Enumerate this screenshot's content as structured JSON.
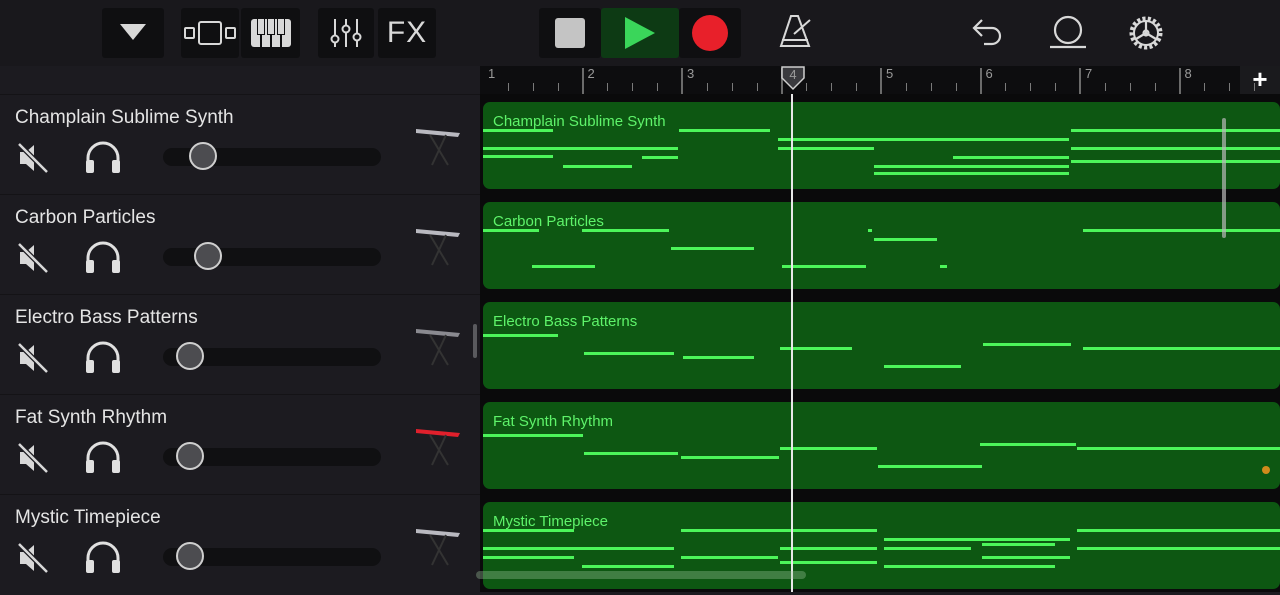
{
  "toolbar": {
    "browser_icon": "triangle-down-icon",
    "tracks_view_icon": "tracks-view-icon",
    "keyboard_icon": "piano-keys-icon",
    "mixer_icon": "mixer-sliders-icon",
    "fx_label": "FX",
    "stop_icon": "stop-icon",
    "play_icon": "play-icon",
    "record_icon": "record-icon",
    "metronome_icon": "metronome-icon",
    "undo_icon": "undo-icon",
    "loop_icon": "loop-browser-icon",
    "settings_icon": "gear-icon",
    "colors": {
      "play": "#3ad65a",
      "record": "#e8202a",
      "note": "#4cf55a",
      "region": "#0d5712"
    }
  },
  "ruler": {
    "bars": [
      "1",
      "2",
      "3",
      "4",
      "5",
      "6",
      "7",
      "8"
    ],
    "playhead_bar": "4",
    "add_label": "+"
  },
  "tracks": [
    {
      "name": "Champlain Sublime Synth",
      "volume": 0.12,
      "instrument": "synth-keyboard-icon",
      "notes": [
        [
          0,
          0.088,
          35
        ],
        [
          0,
          0.245,
          53
        ],
        [
          0,
          0.088,
          61
        ],
        [
          0.1,
          0.187,
          71
        ],
        [
          0.246,
          0.36,
          35
        ],
        [
          0.2,
          0.245,
          62
        ],
        [
          0.37,
          0.49,
          44
        ],
        [
          0.37,
          0.49,
          53
        ],
        [
          0.49,
          0.735,
          44
        ],
        [
          0.49,
          0.735,
          71
        ],
        [
          0.49,
          0.735,
          78
        ],
        [
          0.59,
          0.735,
          62
        ],
        [
          0.738,
          1,
          35
        ],
        [
          0.738,
          1,
          53
        ],
        [
          0.738,
          1,
          66
        ]
      ]
    },
    {
      "name": "Carbon Particles",
      "volume": 0.14,
      "instrument": "synth-keyboard-icon",
      "notes": [
        [
          0,
          0.07,
          35
        ],
        [
          0.124,
          0.233,
          35
        ],
        [
          0.062,
          0.14,
          71
        ],
        [
          0.236,
          0.34,
          53
        ],
        [
          0.375,
          0.48,
          71
        ],
        [
          0.483,
          0.488,
          35
        ],
        [
          0.49,
          0.57,
          44
        ],
        [
          0.573,
          0.582,
          71
        ],
        [
          0.753,
          1,
          35
        ]
      ]
    },
    {
      "name": "Electro Bass Patterns",
      "volume": 0.06,
      "instrument": "modular-synth-icon",
      "notes": [
        [
          0,
          0.094,
          40
        ],
        [
          0.127,
          0.24,
          58
        ],
        [
          0.251,
          0.34,
          62
        ],
        [
          0.373,
          0.463,
          53
        ],
        [
          0.503,
          0.6,
          71
        ],
        [
          0.627,
          0.738,
          49
        ],
        [
          0.753,
          1,
          53
        ]
      ]
    },
    {
      "name": "Fat Synth Rhythm",
      "volume": 0.06,
      "instrument": "red-keyboard-icon",
      "notes": [
        [
          0,
          0.126,
          40
        ],
        [
          0.127,
          0.245,
          58
        ],
        [
          0.249,
          0.372,
          62
        ],
        [
          0.373,
          0.495,
          53
        ],
        [
          0.496,
          0.626,
          71
        ],
        [
          0.623,
          0.744,
          49
        ],
        [
          0.745,
          1,
          53
        ]
      ]
    },
    {
      "name": "Mystic Timepiece",
      "volume": 0.06,
      "instrument": "synth-keyboard-icon",
      "notes": [
        [
          0,
          0.114,
          35
        ],
        [
          0,
          0.24,
          53
        ],
        [
          0,
          0.114,
          62
        ],
        [
          0.124,
          0.24,
          71
        ],
        [
          0.249,
          0.494,
          35
        ],
        [
          0.249,
          0.37,
          62
        ],
        [
          0.373,
          0.494,
          53
        ],
        [
          0.373,
          0.494,
          67
        ],
        [
          0.503,
          0.737,
          44
        ],
        [
          0.503,
          0.612,
          53
        ],
        [
          0.503,
          0.718,
          71
        ],
        [
          0.626,
          0.718,
          49
        ],
        [
          0.626,
          0.737,
          62
        ],
        [
          0.745,
          1,
          35
        ],
        [
          0.745,
          1,
          53
        ]
      ]
    }
  ]
}
